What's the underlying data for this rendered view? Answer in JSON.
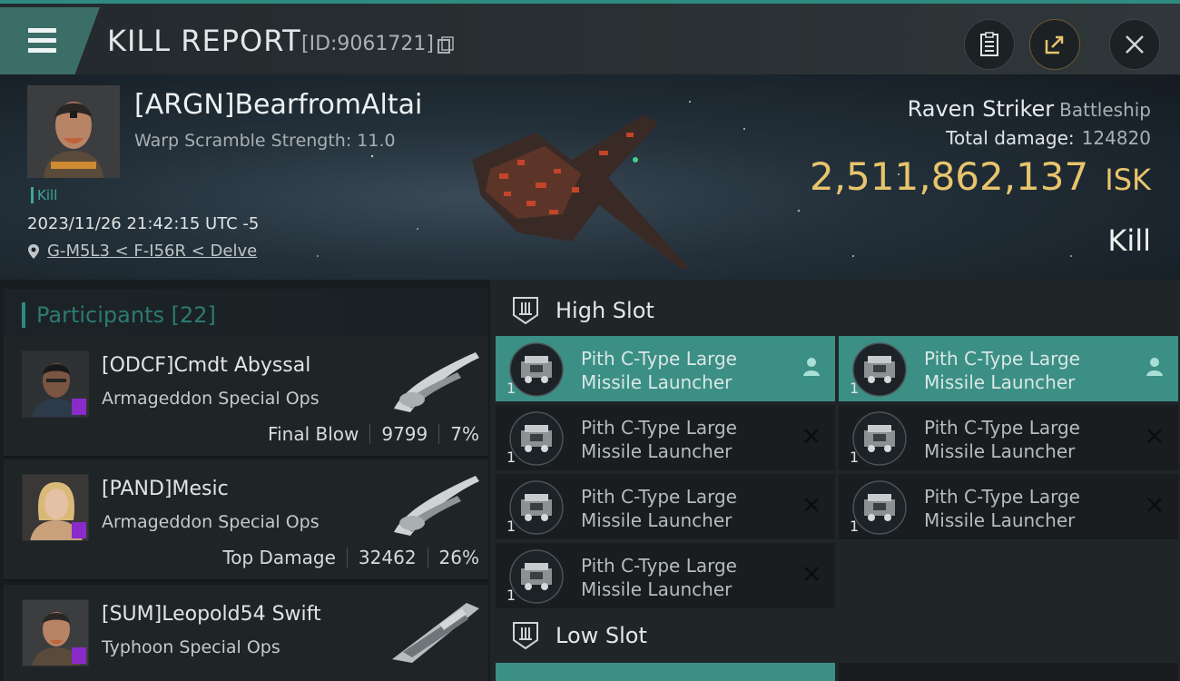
{
  "header": {
    "title": "KILL REPORT",
    "report_id": "[ID:9061721]",
    "icons": [
      "menu-icon",
      "copy-icon",
      "clipboard-icon",
      "share-icon",
      "close-icon"
    ]
  },
  "victim": {
    "name": "[ARGN]BearfromAltai",
    "warp_scramble": "Warp Scramble Strength: 11.0",
    "tag": "Kill",
    "time": "2023/11/26 21:42:15 UTC -5",
    "location": "G-M5L3 < F-I56R < Delve",
    "ship": "Raven Striker",
    "ship_class": "Battleship",
    "total_damage_label": "Total damage:",
    "total_damage": "124820",
    "isk_value": "2,511,862,137",
    "isk_unit": "ISK",
    "result": "Kill"
  },
  "participants": {
    "header": "Participants [22]",
    "rows": [
      {
        "name": "[ODCF]Cmdt Abyssal",
        "ship": "Armageddon Special Ops",
        "role": "Final Blow",
        "damage": "9799",
        "percent": "7%"
      },
      {
        "name": "[PAND]Mesic",
        "ship": "Armageddon Special Ops",
        "role": "Top Damage",
        "damage": "32462",
        "percent": "26%"
      },
      {
        "name": "[SUM]Leopold54 Swift",
        "ship": "Typhoon Special Ops",
        "role": "",
        "damage": "",
        "percent": ""
      }
    ]
  },
  "slots": {
    "high_label": "High Slot",
    "low_label": "Low Slot",
    "modules": [
      {
        "line1": "Pith C-Type Large",
        "line2": "Missile Launcher",
        "qty": "1",
        "status": "pilot-icon"
      },
      {
        "line1": "Pith C-Type Large",
        "line2": "Missile Launcher",
        "qty": "1",
        "status": "pilot-icon"
      },
      {
        "line1": "Pith C-Type Large",
        "line2": "Missile Launcher",
        "qty": "1",
        "status": "destroyed-icon"
      },
      {
        "line1": "Pith C-Type Large",
        "line2": "Missile Launcher",
        "qty": "1",
        "status": "destroyed-icon"
      },
      {
        "line1": "Pith C-Type Large",
        "line2": "Missile Launcher",
        "qty": "1",
        "status": "destroyed-icon"
      },
      {
        "line1": "Pith C-Type Large",
        "line2": "Missile Launcher",
        "qty": "1",
        "status": "destroyed-icon"
      },
      {
        "line1": "Pith C-Type Large",
        "line2": "Missile Launcher",
        "qty": "1",
        "status": "destroyed-icon"
      }
    ]
  },
  "colors": {
    "accent": "#3c8f85",
    "isk": "#e8c46c",
    "implant_badge": "#8a2bc9"
  }
}
